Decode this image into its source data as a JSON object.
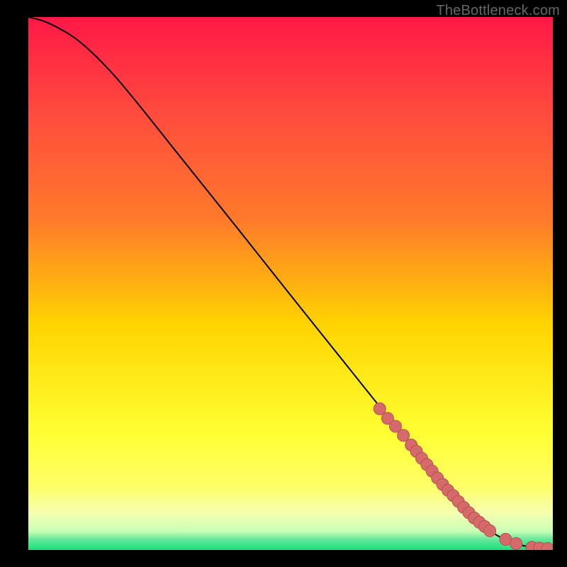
{
  "watermark": "TheBottleneck.com",
  "colors": {
    "black": "#000000",
    "gradient_top": "#ff1846",
    "gradient_mid_upper": "#ff7a2a",
    "gradient_mid": "#ffd500",
    "gradient_lower": "#ffff66",
    "gradient_pale": "#f7ffb0",
    "gradient_green": "#18e07a",
    "curve_stroke": "#000000",
    "marker_fill": "#d46a6a",
    "marker_stroke": "#bb5151"
  },
  "chart_data": {
    "type": "line",
    "title": "",
    "xlabel": "",
    "ylabel": "",
    "xlim": [
      0,
      100
    ],
    "ylim": [
      0,
      100
    ],
    "series": [
      {
        "name": "curve",
        "x": [
          0,
          3,
          6,
          10,
          15,
          20,
          30,
          40,
          50,
          60,
          70,
          78,
          83,
          86,
          88,
          90,
          92,
          94,
          96,
          98,
          100
        ],
        "y": [
          100,
          99.2,
          97.8,
          95.2,
          90.5,
          84.8,
          72.5,
          60.2,
          47.8,
          35.5,
          23.2,
          13.5,
          8.0,
          5.2,
          3.6,
          2.4,
          1.5,
          0.9,
          0.5,
          0.3,
          0.25
        ]
      }
    ],
    "markers": {
      "name": "highlighted-points",
      "x": [
        67,
        68.5,
        70,
        71.5,
        73,
        74,
        75,
        76,
        77,
        78,
        79,
        80,
        81,
        82,
        83,
        84,
        85,
        86,
        87,
        88,
        91,
        93,
        96,
        97.5,
        99
      ],
      "y": [
        26.5,
        24.7,
        23.2,
        21.5,
        19.7,
        18.5,
        17.2,
        16.0,
        14.8,
        13.5,
        12.3,
        11.2,
        10.2,
        9.1,
        8.0,
        7.0,
        6.0,
        5.2,
        4.4,
        3.6,
        2.0,
        1.2,
        0.5,
        0.35,
        0.27
      ]
    }
  }
}
